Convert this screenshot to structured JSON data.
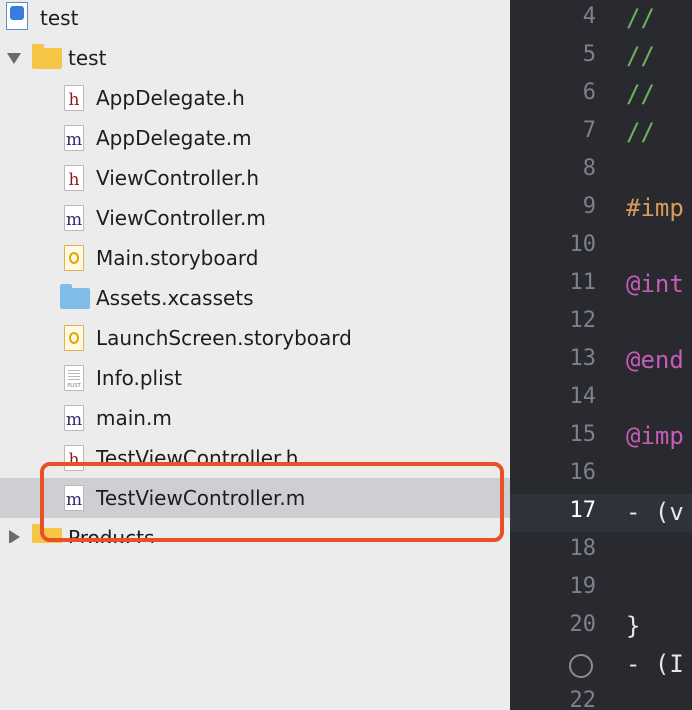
{
  "navigator": {
    "items": [
      {
        "label": "test",
        "kind": "project",
        "icon": "xcode-project-icon"
      },
      {
        "label": "test",
        "kind": "group",
        "icon": "folder-icon",
        "expanded": true
      },
      {
        "label": "AppDelegate.h",
        "kind": "file",
        "icon": "header-file-icon"
      },
      {
        "label": "AppDelegate.m",
        "kind": "file",
        "icon": "implementation-file-icon"
      },
      {
        "label": "ViewController.h",
        "kind": "file",
        "icon": "header-file-icon"
      },
      {
        "label": "ViewController.m",
        "kind": "file",
        "icon": "implementation-file-icon"
      },
      {
        "label": "Main.storyboard",
        "kind": "file",
        "icon": "storyboard-file-icon"
      },
      {
        "label": "Assets.xcassets",
        "kind": "file",
        "icon": "asset-catalog-icon"
      },
      {
        "label": "LaunchScreen.storyboard",
        "kind": "file",
        "icon": "storyboard-file-icon"
      },
      {
        "label": "Info.plist",
        "kind": "file",
        "icon": "plist-file-icon"
      },
      {
        "label": "main.m",
        "kind": "file",
        "icon": "implementation-file-icon"
      },
      {
        "label": "TestViewController.h",
        "kind": "file",
        "icon": "header-file-icon"
      },
      {
        "label": "TestViewController.m",
        "kind": "file",
        "icon": "implementation-file-icon",
        "selected": true
      },
      {
        "label": "Products",
        "kind": "group",
        "icon": "folder-icon",
        "expanded": false
      }
    ],
    "glyphs": {
      "h": "h",
      "m": "m",
      "plist": "PLIST"
    }
  },
  "editor": {
    "lines": [
      {
        "num": "4",
        "code": "//",
        "style": "comment"
      },
      {
        "num": "5",
        "code": "//",
        "style": "comment"
      },
      {
        "num": "6",
        "code": "//",
        "style": "comment"
      },
      {
        "num": "7",
        "code": "//",
        "style": "comment"
      },
      {
        "num": "8",
        "code": "",
        "style": "plain"
      },
      {
        "num": "9",
        "code": "#imp",
        "style": "preprocessor"
      },
      {
        "num": "10",
        "code": "",
        "style": "plain"
      },
      {
        "num": "11",
        "code": "@int",
        "style": "keyword"
      },
      {
        "num": "12",
        "code": "",
        "style": "plain"
      },
      {
        "num": "13",
        "code": "@end",
        "style": "keyword"
      },
      {
        "num": "14",
        "code": "",
        "style": "plain"
      },
      {
        "num": "15",
        "code": "@imp",
        "style": "keyword"
      },
      {
        "num": "16",
        "code": "",
        "style": "plain"
      },
      {
        "num": "17",
        "code": "- (v",
        "style": "plain",
        "current": true
      },
      {
        "num": "18",
        "code": "",
        "style": "plain"
      },
      {
        "num": "19",
        "code": "",
        "style": "plain"
      },
      {
        "num": "20",
        "code": "}",
        "style": "plain"
      },
      {
        "num": "",
        "code": "- (I",
        "style": "plain",
        "marker": "breakpoint-circle"
      },
      {
        "num": "22",
        "code": "",
        "style": "plain"
      }
    ]
  },
  "colors": {
    "selection_bg": "#cfcfd3",
    "highlight_border": "#e8502a",
    "editor_bg": "#292a30",
    "comment": "#6bb35f",
    "keyword": "#c65cb5",
    "preprocessor": "#d69a5a"
  }
}
